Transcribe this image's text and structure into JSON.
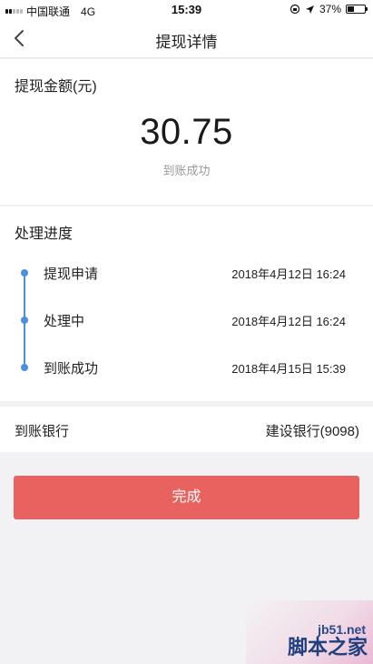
{
  "status_bar": {
    "carrier": "中国联通",
    "network": "4G",
    "time": "15:39",
    "battery": "37%",
    "battery_level": 0.37
  },
  "header": {
    "title": "提现详情"
  },
  "amount": {
    "label": "提现金额(元)",
    "value": "30.75",
    "status": "到账成功"
  },
  "progress": {
    "title": "处理进度",
    "steps": [
      {
        "label": "提现申请",
        "time": "2018年4月12日 16:24"
      },
      {
        "label": "处理中",
        "time": "2018年4月12日 16:24"
      },
      {
        "label": "到账成功",
        "time": "2018年4月15日 15:39"
      }
    ]
  },
  "bank": {
    "label": "到账银行",
    "value": "建设银行(9098)"
  },
  "actions": {
    "done_label": "完成"
  },
  "watermark": {
    "url": "jb51.net",
    "name": "脚本之家"
  },
  "colors": {
    "accent": "#4a90e2",
    "button": "#e8625f",
    "background": "#f2f2f4"
  }
}
